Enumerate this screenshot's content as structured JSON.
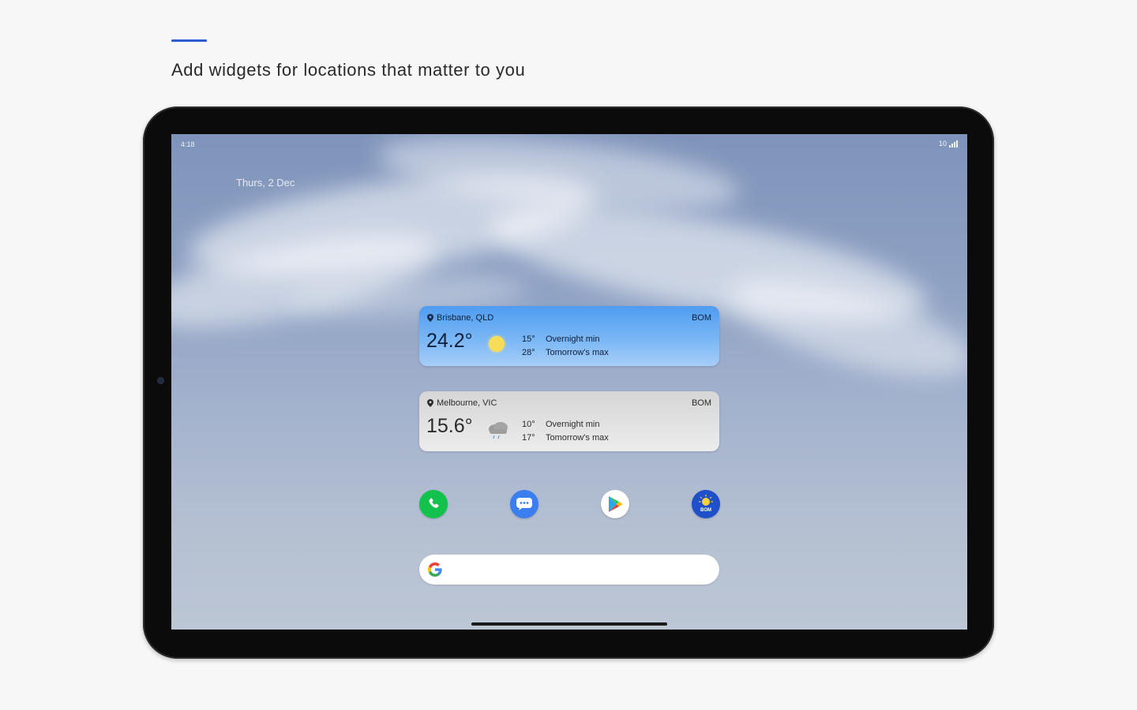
{
  "headline": "Add widgets for locations that matter to you",
  "colors": {
    "accent": "#2f5bd6",
    "brisbane_widget": "#4f9cf1",
    "melbourne_widget": "#d6d6d6"
  },
  "status_bar": {
    "left": "4:18",
    "right": "10"
  },
  "lock_date": "Thurs, 2 Dec",
  "widgets": [
    {
      "location": "Brisbane, QLD",
      "brand": "BOM",
      "temp": "24.2°",
      "condition_icon": "sun-icon",
      "overnight_min": "15°",
      "overnight_label": "Overnight min",
      "tomorrow_max": "28°",
      "tomorrow_label": "Tomorrow's max"
    },
    {
      "location": "Melbourne, VIC",
      "brand": "BOM",
      "temp": "15.6°",
      "condition_icon": "rain-cloud-icon",
      "overnight_min": "10°",
      "overnight_label": "Overnight min",
      "tomorrow_max": "17°",
      "tomorrow_label": "Tomorrow's max"
    }
  ],
  "dock_apps": [
    {
      "name": "phone",
      "icon": "phone-icon"
    },
    {
      "name": "messages",
      "icon": "messages-icon"
    },
    {
      "name": "play-store",
      "icon": "play-store-icon"
    },
    {
      "name": "bom-weather",
      "icon": "bom-icon",
      "label": "BOM"
    }
  ],
  "search": {
    "icon": "google-g-icon"
  }
}
